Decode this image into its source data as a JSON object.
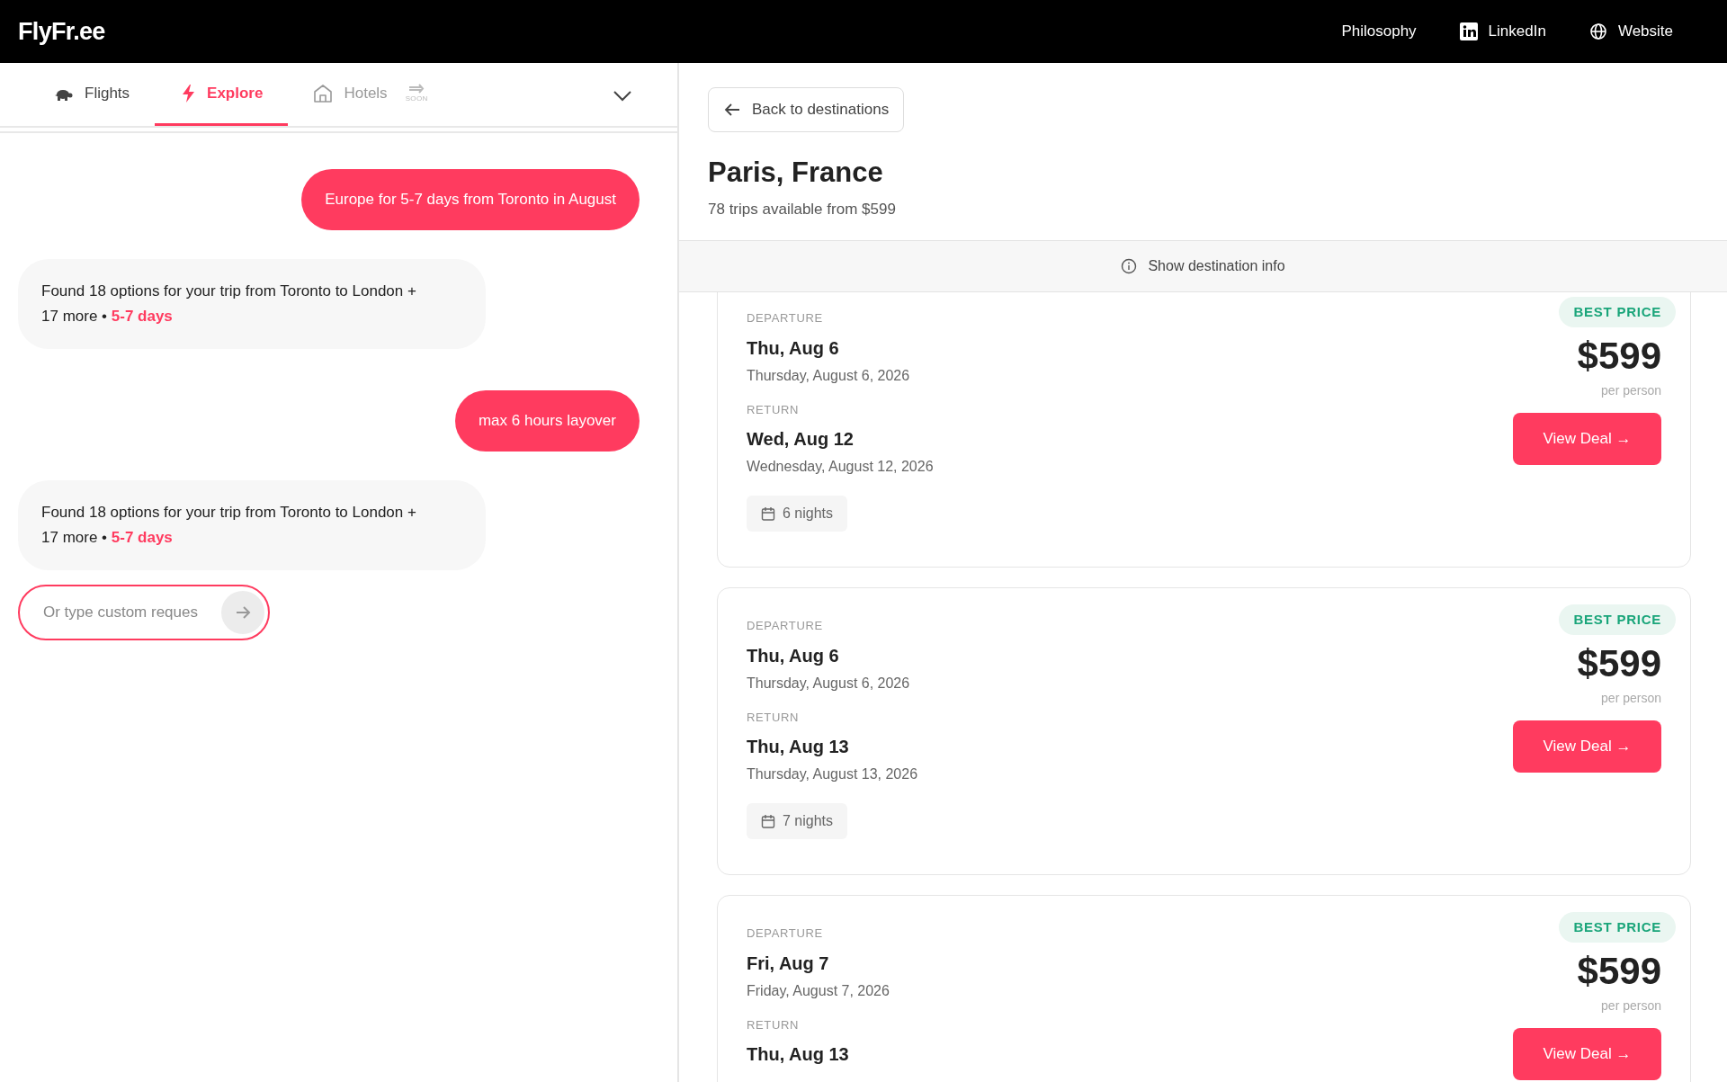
{
  "header": {
    "logo": "FlyFr.ee",
    "links": [
      {
        "kind": "text",
        "label": "Philosophy"
      },
      {
        "kind": "linkedin",
        "label": "LinkedIn"
      },
      {
        "kind": "globe",
        "label": "Website"
      }
    ]
  },
  "tabs": [
    {
      "label": "Flights",
      "selected": false,
      "disabled": false
    },
    {
      "label": "Explore",
      "selected": true,
      "disabled": false
    },
    {
      "label": "Hotels",
      "selected": false,
      "disabled": true,
      "badge": "SOON"
    }
  ],
  "chat": {
    "messages": [
      {
        "kind": "user",
        "text": "Europe for 5-7 days from Toronto in August"
      },
      {
        "kind": "bot",
        "text": "Found 18 options for your trip from Toronto to London + 17 more •",
        "highlight": "5-7 days"
      },
      {
        "kind": "user",
        "text": "max 6 hours layover"
      },
      {
        "kind": "bot",
        "text": "Found 18 options for your trip from Toronto to London + 17 more •",
        "highlight": "5-7 days"
      }
    ],
    "input": {
      "placeholder": "Or type custom reques"
    }
  },
  "destination": {
    "back": "Back to destinations",
    "title": "Paris, France",
    "subtitle": "78 trips available from $599",
    "info_toggle": "Show destination info"
  },
  "trips": [
    {
      "badge": "BEST PRICE",
      "departure_label": "DEPARTURE",
      "departure_short": "Thu, Aug 6",
      "departure_long": "Thursday, August 6, 2026",
      "return_label": "RETURN",
      "return_short": "Wed, Aug 12",
      "return_long": "Wednesday, August 12, 2026",
      "nights": "6 nights",
      "price": "$599",
      "price_note": "per person",
      "action": "View Deal →"
    },
    {
      "badge": "BEST PRICE",
      "departure_label": "DEPARTURE",
      "departure_short": "Thu, Aug 6",
      "departure_long": "Thursday, August 6, 2026",
      "return_label": "RETURN",
      "return_short": "Thu, Aug 13",
      "return_long": "Thursday, August 13, 2026",
      "nights": "7 nights",
      "price": "$599",
      "price_note": "per person",
      "action": "View Deal →"
    },
    {
      "badge": "BEST PRICE",
      "departure_label": "DEPARTURE",
      "departure_short": "Fri, Aug 7",
      "departure_long": "Friday, August 7, 2026",
      "return_label": "RETURN",
      "return_short": "Thu, Aug 13",
      "price": "$599",
      "price_note": "per person",
      "action": "View Deal →"
    }
  ]
}
